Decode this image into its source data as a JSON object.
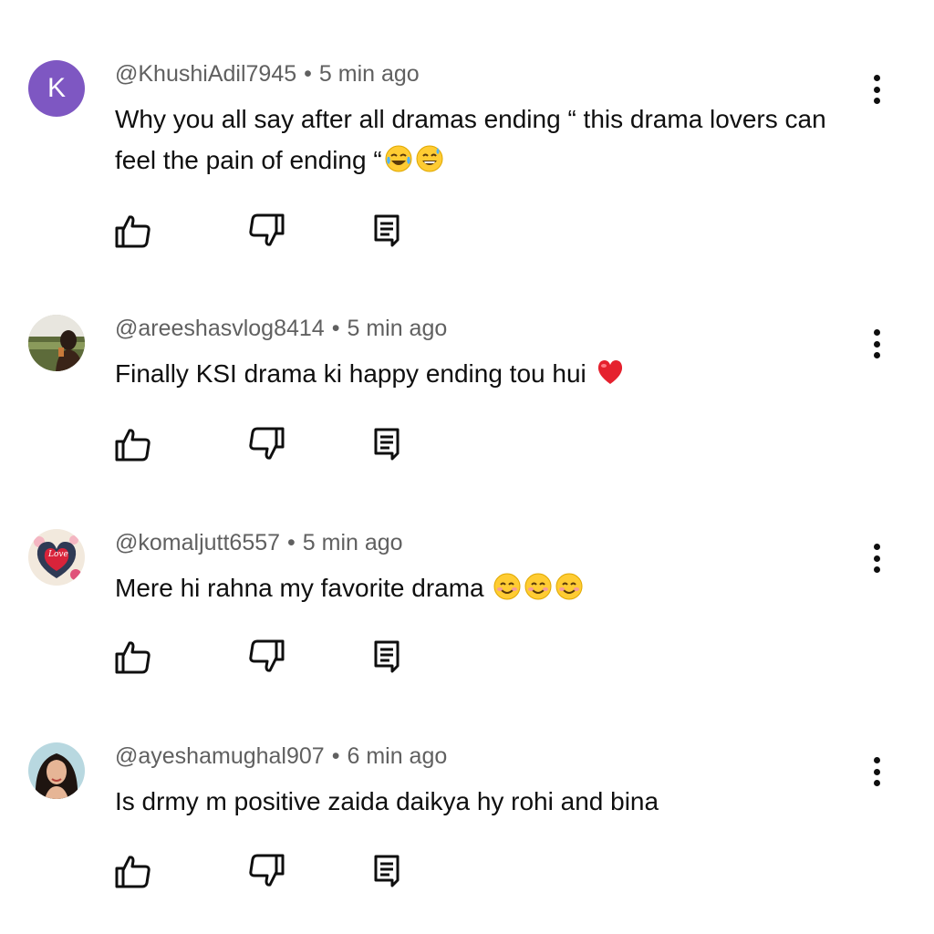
{
  "comments": [
    {
      "author": "@KhushiAdil7945",
      "time": "5 min ago",
      "separator": "•",
      "text": "Why you all say after all dramas ending “ this drama lovers can feel the pain of ending “",
      "emojis": [
        "face-with-tears-of-joy",
        "grinning-face-with-sweat"
      ],
      "avatar_letter": "K",
      "avatar_color": "#7e57c2"
    },
    {
      "author": "@areeshasvlog8414",
      "time": "5 min ago",
      "separator": "•",
      "text": "Finally KSI drama ki happy ending tou hui",
      "emojis": [
        "red-heart"
      ]
    },
    {
      "author": "@komaljutt6557",
      "time": "5 min ago",
      "separator": "•",
      "text": "Mere hi rahna my favorite drama",
      "emojis": [
        "smiling-face-with-smiling-eyes",
        "smiling-face-with-smiling-eyes",
        "smiling-face-with-smiling-eyes"
      ],
      "avatar_text": "Love"
    },
    {
      "author": "@ayeshamughal907",
      "time": "6 min ago",
      "separator": "•",
      "text": "Is drmy m positive zaida daikya hy rohi and bina",
      "emojis": []
    }
  ],
  "icons": {
    "like": "thumb-up-icon",
    "dislike": "thumb-down-icon",
    "reply": "reply-icon",
    "more": "more-vert-icon"
  },
  "colors": {
    "text": "#0f0f0f",
    "meta": "#606060",
    "background": "#ffffff"
  }
}
